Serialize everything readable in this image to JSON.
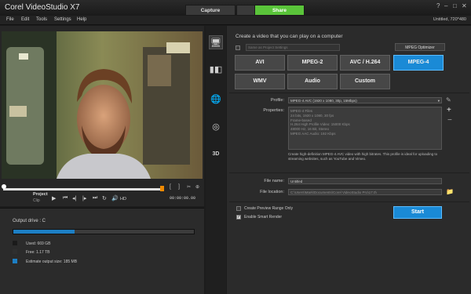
{
  "app": {
    "title": "Corel VideoStudio X7"
  },
  "mode_tabs": [
    {
      "label": "Capture",
      "active": false
    },
    {
      "label": "Edit",
      "active": false
    },
    {
      "label": "Share",
      "active": true
    }
  ],
  "menu": [
    "File",
    "Edit",
    "Tools",
    "Settings",
    "Help"
  ],
  "project_info": "Untitled, 720*480",
  "player": {
    "mode_label": "Project",
    "timecode": "00:00:00.00"
  },
  "output_drive": {
    "label": "Output drive : C",
    "used_fraction": 0.34,
    "legend": [
      {
        "label": "Used:  669 GB",
        "color": "#1b1b1b"
      },
      {
        "label": "Free:  1.17 TB",
        "color": "#2f2f2f"
      },
      {
        "label": "Estimate output size:  185 MB",
        "color": "#1d7fc4"
      }
    ]
  },
  "share": {
    "heading": "Create a video that you can play on a computer",
    "same_as_project": "Same as Project Settings",
    "mpeg_optimizer": "MPEG Optimizer",
    "formats_row1": [
      "AVI",
      "MPEG-2",
      "AVC / H.264",
      "MPEG-4"
    ],
    "formats_row2": [
      "WMV",
      "Audio",
      "Custom"
    ],
    "selected_format": "MPEG-4",
    "profile_label": "Profile:",
    "profile_value": "MPEG-4 AVC (1920 x 1080, 30p, 15Mbps)",
    "properties_label": "Properties:",
    "properties": [
      "MPEG-4 Files",
      "24 bits, 1920 x 1080, 30 fps",
      "Frame-based",
      "H.264 High Profile Video: 15000 Kbps",
      "48000 Hz, 16 Bit, Stereo",
      "MPEG AAC Audio: 192 Kbps"
    ],
    "description": "Create high-definition MPEG-4 AVC video with high bitrates. This profile is ideal for uploading to streaming websites, such as YouTube and Vimeo.",
    "file_name_label": "File name:",
    "file_name_value": "Untitled",
    "file_location_label": "File location:",
    "file_location_value": "C:\\Users\\Mark\\Documents\\Corel VideoStudio Pro\\17.0\\",
    "create_preview_range": "Create Preview Range Only",
    "enable_smart_render": "Enable Smart Render",
    "start_label": "Start"
  },
  "colors": {
    "accent": "#1a8ad6",
    "share_tab": "#5ac43a",
    "scrub_end": "#f08a00"
  }
}
